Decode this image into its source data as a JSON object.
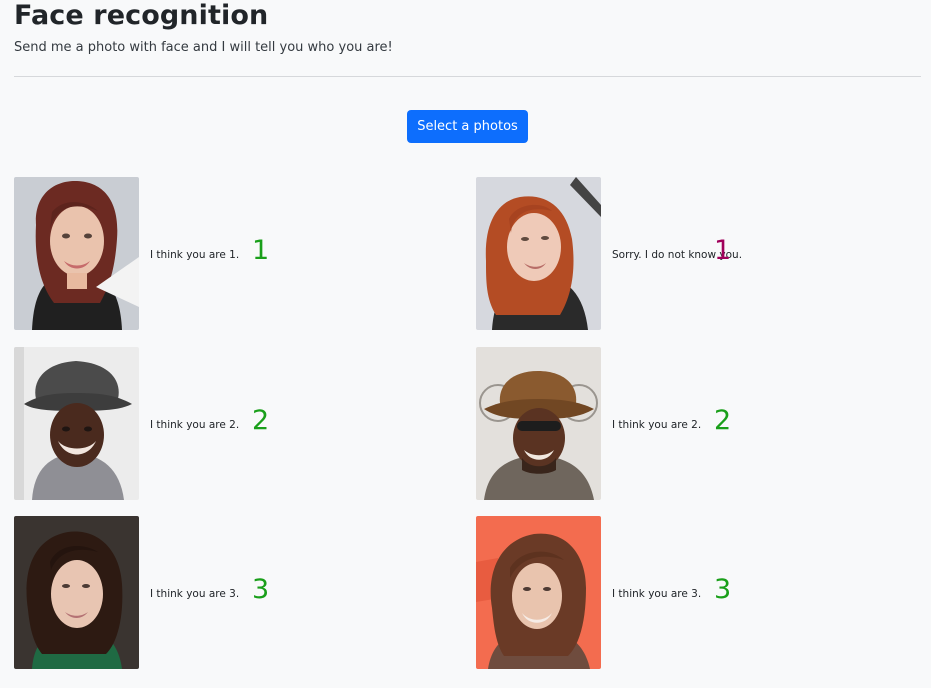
{
  "header": {
    "title": "Face recognition",
    "subtitle": "Send me a photo with face and I will tell you who you are!"
  },
  "actions": {
    "select_label": "Select a photos"
  },
  "colors": {
    "primary": "#0d6efd",
    "success": "#1a9f1a",
    "unknown": "#a0005a"
  },
  "results": [
    {
      "message": "I think you are 1.",
      "id": "1",
      "status": "match"
    },
    {
      "message": "Sorry. I do not know you.",
      "id": "1",
      "status": "unknown"
    },
    {
      "message": "I think you are 2.",
      "id": "2",
      "status": "match"
    },
    {
      "message": "I think you are 2.",
      "id": "2",
      "status": "match"
    },
    {
      "message": "I think you are 3.",
      "id": "3",
      "status": "match"
    },
    {
      "message": "I think you are 3.",
      "id": "3",
      "status": "match"
    }
  ]
}
